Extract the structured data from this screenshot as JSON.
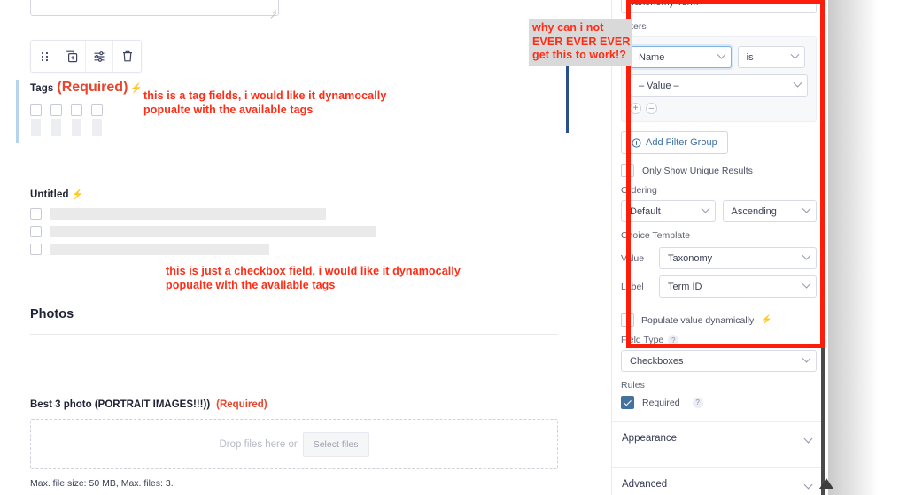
{
  "form": {
    "toolbar": {
      "icons": [
        "drag-handle-icon",
        "duplicate-icon",
        "settings-sliders-icon",
        "trash-icon"
      ]
    },
    "tags_field": {
      "label": "Tags",
      "required_text": "(Required)",
      "bolt": "⚡",
      "checkbox_count": 4
    },
    "untitled_field": {
      "label": "Untitled",
      "bolt": "⚡",
      "rows": [
        {
          "skeleton_width": 312
        },
        {
          "skeleton_width": 368
        },
        {
          "skeleton_width": 248
        }
      ]
    },
    "photos_section": {
      "heading": "Photos"
    },
    "upload_field": {
      "label": "Best 3 photo (PORTRAIT IMAGES!!!))",
      "required_text": "(Required)",
      "drop_text": "Drop files here or",
      "select_button": "Select files",
      "max_note": "Max. file size: 50 MB, Max. files: 3."
    }
  },
  "annotations": {
    "tags": "this is a tag fields, i would like it dynamocally\npopualte with the available tags",
    "checkbox": "this is just a checkbox field, i would like it dynamocally\npopualte with the available tags",
    "why": "why can i not\nEVER EVER EVER\nget this to work!?",
    "highlight_color": "#fc1d0b",
    "text_color": "#ff2d16"
  },
  "settings_panel": {
    "source_select": "Taxonomy Term",
    "filters": {
      "label": "Filters",
      "field_select": "Name",
      "operator_select": "is",
      "value_select": "– Value –",
      "add_button": "+",
      "remove_button": "–"
    },
    "add_filter_group_button": "Add Filter Group",
    "unique_results": {
      "label": "Only Show Unique Results",
      "checked": false
    },
    "ordering": {
      "label": "Ordering",
      "field": "Default",
      "direction": "Ascending"
    },
    "choice_template": {
      "label": "Choice Template",
      "value_key": "Value",
      "value_select": "Taxonomy",
      "label_key": "Label",
      "label_select": "Term ID"
    },
    "populate_dynamically": {
      "label": "Populate value dynamically",
      "bolt": "⚡",
      "checked": false
    },
    "field_type": {
      "label": "Field Type",
      "help": "?",
      "value": "Checkboxes"
    },
    "rules": {
      "label": "Rules",
      "required_label": "Required",
      "required_checked": true,
      "help": "?"
    },
    "accordions": [
      {
        "label": "Appearance"
      },
      {
        "label": "Advanced"
      }
    ]
  }
}
